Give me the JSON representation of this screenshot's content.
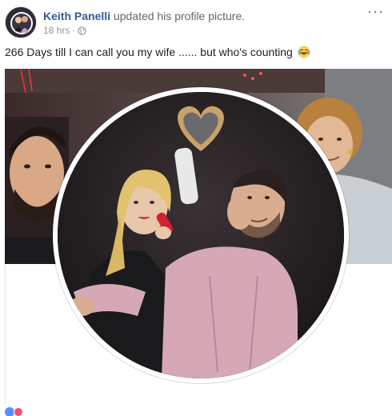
{
  "post": {
    "author": "Keith Panelli",
    "action": "updated his profile picture.",
    "timestamp": "18 hrs",
    "privacy_icon": "globe-icon",
    "more_icon": "ellipsis-icon",
    "text": "266 Days till I can call you my wife ...... but who's counting",
    "emoji": "laughing-tears-emoji"
  },
  "reactions": {
    "icons": [
      "like-reaction-icon",
      "love-reaction-icon"
    ],
    "names": "",
    "count": ""
  },
  "colors": {
    "author_link": "#365899",
    "meta_gray": "#90949c",
    "like_blue": "#5890ff",
    "love_red": "#f25268"
  }
}
